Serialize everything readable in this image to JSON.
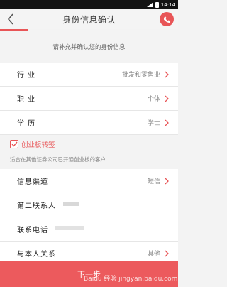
{
  "status": {
    "time": "14:14"
  },
  "header": {
    "title": "身份信息确认"
  },
  "hint": "请补充并确认您的身份信息",
  "group1": [
    {
      "label": "行 业",
      "value": "批发和零售业"
    },
    {
      "label": "职 业",
      "value": "个体"
    },
    {
      "label": "学 历",
      "value": "学士"
    }
  ],
  "check": {
    "label": "创业板转签",
    "note": "适合在其他证券公司已开通创业板的客户"
  },
  "group2": {
    "channel": {
      "label": "信息渠道",
      "value": "短信"
    },
    "contact": {
      "label": "第二联系人"
    },
    "phone": {
      "label": "联系电话"
    },
    "relation": {
      "label": "与本人关系",
      "value": "其他"
    }
  },
  "footer": {
    "next_label": "下一步",
    "watermark": "Baidu 经验 jingyan.baidu.com"
  },
  "colors": {
    "accent": "#e85557",
    "button": "#ec5a5d"
  }
}
